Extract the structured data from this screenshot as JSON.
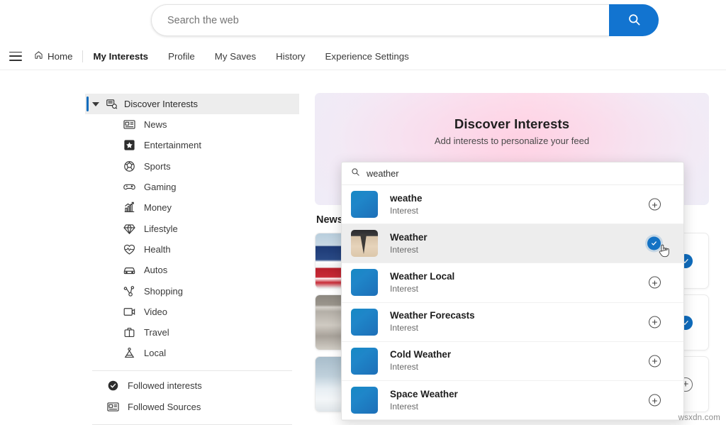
{
  "search": {
    "placeholder": "Search the web",
    "button_icon": "search-icon"
  },
  "nav": {
    "menu_icon": "hamburger-icon",
    "home": {
      "label": "Home",
      "icon": "home-icon"
    },
    "items": [
      {
        "label": "My Interests",
        "active": true
      },
      {
        "label": "Profile",
        "active": false
      },
      {
        "label": "My Saves",
        "active": false
      },
      {
        "label": "History",
        "active": false
      },
      {
        "label": "Experience Settings",
        "active": false
      }
    ]
  },
  "sidebar": {
    "header": {
      "label": "Discover Interests",
      "icon": "discover-icon",
      "expanded": true
    },
    "categories": [
      {
        "label": "News",
        "icon": "news-icon"
      },
      {
        "label": "Entertainment",
        "icon": "star-icon"
      },
      {
        "label": "Sports",
        "icon": "ball-icon"
      },
      {
        "label": "Gaming",
        "icon": "gamepad-icon"
      },
      {
        "label": "Money",
        "icon": "chart-icon"
      },
      {
        "label": "Lifestyle",
        "icon": "diamond-icon"
      },
      {
        "label": "Health",
        "icon": "heart-pulse-icon"
      },
      {
        "label": "Autos",
        "icon": "car-icon"
      },
      {
        "label": "Shopping",
        "icon": "share-icon"
      },
      {
        "label": "Video",
        "icon": "video-icon"
      },
      {
        "label": "Travel",
        "icon": "suitcase-icon"
      },
      {
        "label": "Local",
        "icon": "location-person-icon"
      }
    ],
    "followed": [
      {
        "label": "Followed interests",
        "icon": "check-filled-icon"
      },
      {
        "label": "Followed Sources",
        "icon": "news-icon"
      }
    ]
  },
  "hero": {
    "title": "Discover Interests",
    "subtitle": "Add interests to personalize your feed",
    "accent_pink": "#fbe9f2",
    "accent_blue": "#eaf0fa"
  },
  "main": {
    "section_title": "News",
    "cards": [
      {
        "thumb": "flag-image",
        "action": "check-circle",
        "state": "followed"
      },
      {
        "thumb": "building-image",
        "action": "check-circle",
        "state": "followed"
      },
      {
        "thumb": "beach-image",
        "action": "plus-circle",
        "state": "not-followed"
      }
    ]
  },
  "dropdown": {
    "search": {
      "value": "weather",
      "icon": "search-icon"
    },
    "results": [
      {
        "title": "weathe",
        "subtitle": "Interest",
        "thumb": "blue",
        "action": "plus-circle",
        "highlighted": false
      },
      {
        "title": "Weather",
        "subtitle": "Interest",
        "thumb": "storm",
        "action": "check-circle",
        "highlighted": true
      },
      {
        "title": "Weather Local",
        "subtitle": "Interest",
        "thumb": "blue",
        "action": "plus-circle",
        "highlighted": false
      },
      {
        "title": "Weather Forecasts",
        "subtitle": "Interest",
        "thumb": "blue",
        "action": "plus-circle",
        "highlighted": false
      },
      {
        "title": "Cold Weather",
        "subtitle": "Interest",
        "thumb": "blue",
        "action": "plus-circle",
        "highlighted": false
      },
      {
        "title": "Space Weather",
        "subtitle": "Interest",
        "thumb": "blue",
        "action": "plus-circle",
        "highlighted": false
      }
    ]
  },
  "watermark": {
    "text": "wsxdn.com"
  },
  "colors": {
    "accent": "#1274d0",
    "check": "#0f6cbd",
    "selected_bg": "#ededed"
  }
}
